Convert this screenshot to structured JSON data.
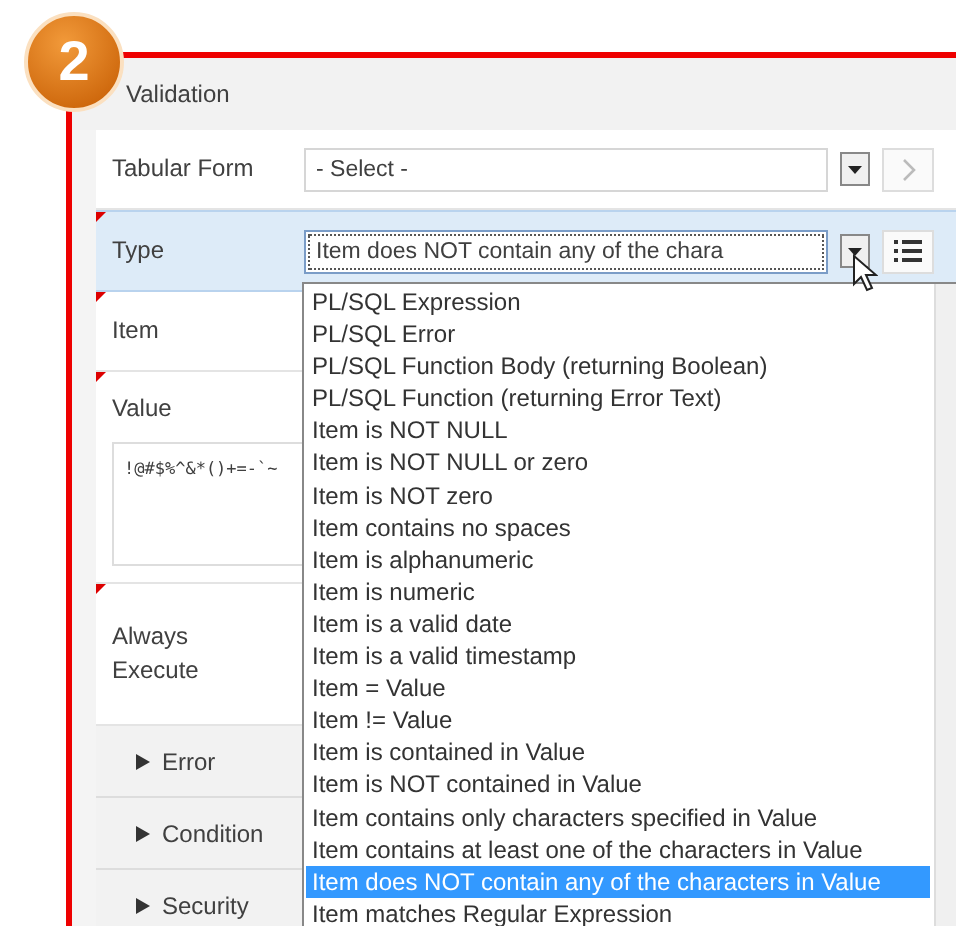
{
  "step_badge": "2",
  "panel": {
    "title": "Validation"
  },
  "fields": [
    {
      "kind": "select",
      "label": "Tabular Form",
      "value": "- Select -",
      "highlighted": false,
      "required": false
    },
    {
      "kind": "select",
      "label": "Type",
      "value": "Item does NOT contain any of the chara",
      "highlighted": true,
      "required": true
    },
    {
      "kind": "blank",
      "label": "Item",
      "highlighted": false,
      "required": true
    },
    {
      "kind": "textarea",
      "label": "Value",
      "value": "!@#$%^&*()+=-`~",
      "highlighted": false,
      "required": true
    },
    {
      "kind": "blank",
      "label": "Always Execute",
      "highlighted": false,
      "required": true
    }
  ],
  "sections": [
    {
      "label": "Error"
    },
    {
      "label": "Condition"
    },
    {
      "label": "Security"
    }
  ],
  "dropdown": {
    "options": [
      {
        "label": "PL/SQL Expression",
        "selected": false
      },
      {
        "label": "PL/SQL Error",
        "selected": false
      },
      {
        "label": "PL/SQL Function Body (returning Boolean)",
        "selected": false
      },
      {
        "label": "PL/SQL Function (returning Error Text)",
        "selected": false
      },
      {
        "label": "Item is NOT NULL",
        "selected": false
      },
      {
        "label": "Item is NOT NULL or zero",
        "selected": false
      },
      {
        "label": "Item is NOT zero",
        "selected": false
      },
      {
        "label": "Item contains no spaces",
        "selected": false
      },
      {
        "label": "Item is alphanumeric",
        "selected": false
      },
      {
        "label": "Item is numeric",
        "selected": false
      },
      {
        "label": "Item is a valid date",
        "selected": false
      },
      {
        "label": "Item is a valid timestamp",
        "selected": false
      },
      {
        "label": "Item = Value",
        "selected": false
      },
      {
        "label": "Item != Value",
        "selected": false
      },
      {
        "label": "Item is contained in Value",
        "selected": false
      },
      {
        "label": "Item is NOT contained in Value",
        "selected": false
      },
      {
        "label": "Item contains only characters specified in Value",
        "selected": false
      },
      {
        "label": "Item contains at least one of the characters in Value",
        "selected": false
      },
      {
        "label": "Item does NOT contain any of the characters in Value",
        "selected": true
      },
      {
        "label": "Item matches Regular Expression",
        "selected": false
      }
    ]
  }
}
